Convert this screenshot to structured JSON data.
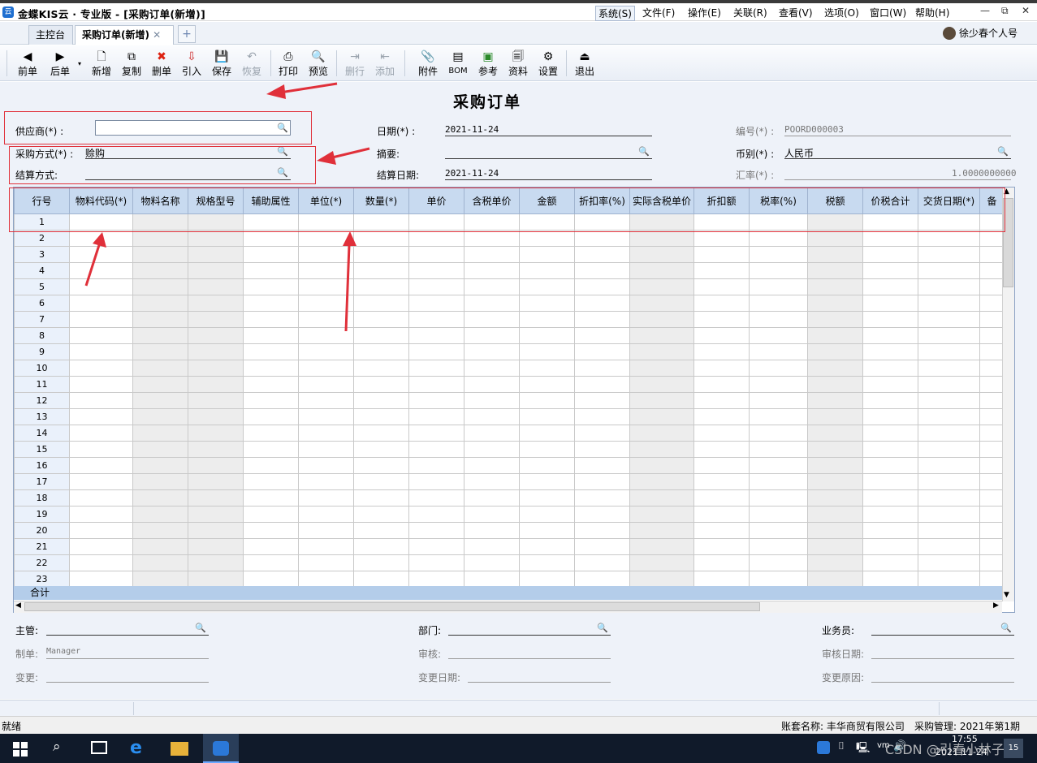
{
  "app": {
    "title": "金蝶KIS云 · 专业版 - [采购订单(新增)]",
    "icon_text": "云"
  },
  "menubar": {
    "items": [
      "系统(S)",
      "文件(F)",
      "操作(E)",
      "关联(R)",
      "查看(V)",
      "选项(O)",
      "窗口(W)",
      "帮助(H)"
    ]
  },
  "window_controls": {
    "minimize": "—",
    "restore": "⧉",
    "close": "✕"
  },
  "tabs": [
    {
      "label": "主控台"
    },
    {
      "label": "采购订单(新增)",
      "close": "✕"
    }
  ],
  "tab_add": "+",
  "user": {
    "name": "徐少春个人号"
  },
  "toolbar": [
    {
      "label": "前单",
      "icon": "◀",
      "enabled": true
    },
    {
      "label": "后单",
      "icon": "▶",
      "enabled": true
    },
    {
      "label": "新增",
      "icon": "🗋",
      "enabled": true
    },
    {
      "label": "复制",
      "icon": "⧉",
      "enabled": true
    },
    {
      "label": "删单",
      "icon": "✖",
      "enabled": true
    },
    {
      "label": "引入",
      "icon": "⇩",
      "enabled": true
    },
    {
      "label": "保存",
      "icon": "💾",
      "enabled": true
    },
    {
      "label": "恢复",
      "icon": "↶",
      "enabled": false
    },
    {
      "label": "打印",
      "icon": "⎙",
      "enabled": true
    },
    {
      "label": "预览",
      "icon": "🔍",
      "enabled": true
    },
    {
      "label": "删行",
      "icon": "⇥",
      "enabled": false
    },
    {
      "label": "添加",
      "icon": "⇤",
      "enabled": false
    },
    {
      "label": "附件",
      "icon": "📎",
      "enabled": true
    },
    {
      "label": "BOM",
      "icon": "▤",
      "enabled": true
    },
    {
      "label": "参考",
      "icon": "▣",
      "enabled": true
    },
    {
      "label": "资料",
      "icon": "🗐",
      "enabled": true
    },
    {
      "label": "设置",
      "icon": "⚙",
      "enabled": true
    },
    {
      "label": "退出",
      "icon": "⏏",
      "enabled": true
    }
  ],
  "form": {
    "title": "采购订单",
    "supplier": {
      "label": "供应商(*) :",
      "value": ""
    },
    "purchase_method": {
      "label": "采购方式(*) :",
      "value": "赊购"
    },
    "settlement_method": {
      "label": "结算方式:",
      "value": ""
    },
    "date": {
      "label": "日期(*) :",
      "value": "2021-11-24"
    },
    "summary": {
      "label": "摘要:",
      "value": ""
    },
    "settlement_date": {
      "label": "结算日期:",
      "value": "2021-11-24"
    },
    "number": {
      "label": "编号(*) :",
      "value": "POORD000003"
    },
    "currency": {
      "label": "币别(*) :",
      "value": "人民币"
    },
    "exchange_rate": {
      "label": "汇率(*) :",
      "value": "1.0000000000"
    }
  },
  "grid": {
    "columns": [
      "行号",
      "物料代码(*)",
      "物料名称",
      "规格型号",
      "辅助属性",
      "单位(*)",
      "数量(*)",
      "单价",
      "含税单价",
      "金额",
      "折扣率(%)",
      "实际含税单价",
      "折扣额",
      "税率(%)",
      "税额",
      "价税合计",
      "交货日期(*)",
      "备"
    ],
    "rows": [
      "1",
      "2",
      "3",
      "4",
      "5",
      "6",
      "7",
      "8",
      "9",
      "10",
      "11",
      "12",
      "13",
      "14",
      "15",
      "16",
      "17",
      "18",
      "19",
      "20",
      "21",
      "22",
      "23"
    ],
    "sum_label": "合计"
  },
  "footer": {
    "supervisor": {
      "label": "主管:",
      "value": ""
    },
    "department": {
      "label": "部门:",
      "value": ""
    },
    "salesman": {
      "label": "业务员:",
      "value": ""
    },
    "maker": {
      "label": "制单:",
      "value": "Manager"
    },
    "reviewer": {
      "label": "审核:",
      "value": ""
    },
    "review_date": {
      "label": "审核日期:",
      "value": ""
    },
    "change": {
      "label": "变更:",
      "value": ""
    },
    "change_date": {
      "label": "变更日期:",
      "value": ""
    },
    "change_reason": {
      "label": "变更原因:",
      "value": ""
    }
  },
  "statusbar": {
    "left": "就绪",
    "account": "账套名称: 丰华商贸有限公司",
    "module": "采购管理: 2021年第1期"
  },
  "taskbar": {
    "time": "17:55",
    "date": "2021-11-24",
    "watermark": "CSDN @引春小林子",
    "badge": "15"
  },
  "colors": {
    "header_bg": "#c8daf0",
    "form_bg": "#eef2f9",
    "annotation_red": "#e0303a"
  }
}
